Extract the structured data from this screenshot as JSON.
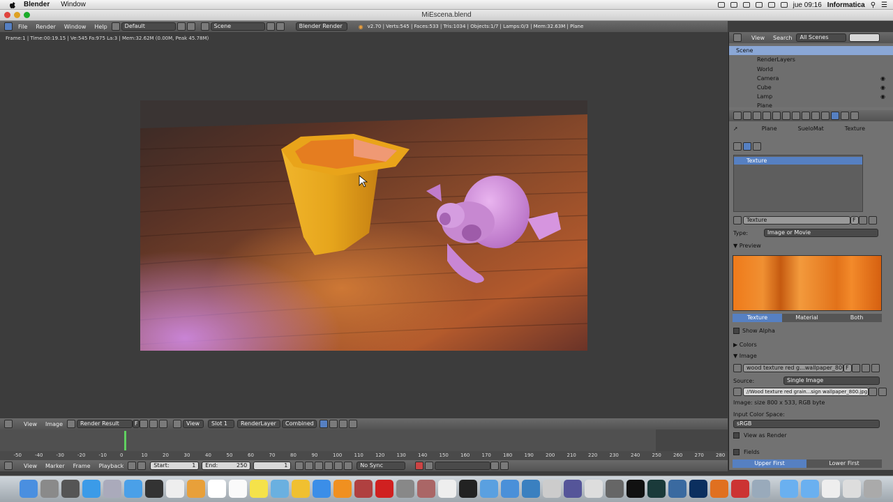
{
  "mac_menubar": {
    "app_name": "Blender",
    "menu": [
      "Window"
    ],
    "clock": "jue 09:16",
    "user": "Informatica"
  },
  "window": {
    "title": "MiEscena.blend"
  },
  "info_header": {
    "menus": [
      "File",
      "Render",
      "Window",
      "Help"
    ],
    "layout": "Default",
    "scene": "Scene",
    "engine": "Blender Render",
    "stats": "v2.70 | Verts:545 | Faces:533 | Tris:1034 | Objects:1/7 | Lamps:0/3 | Mem:32.63M | Plane"
  },
  "render_status": "Frame:1 | Time:00:19.15 | Ve:545 Fa:975 La:3 | Mem:32.62M (0.00M, Peak 45.78M)",
  "image_editor_header": {
    "menus": [
      "View",
      "Image"
    ],
    "image_name": "Render Result",
    "f_label": "F",
    "view_mode": "View",
    "slot": "Slot 1",
    "layer": "RenderLayer",
    "pass": "Combined"
  },
  "timeline": {
    "ruler": [
      "-50",
      "-40",
      "-30",
      "-20",
      "-10",
      "0",
      "10",
      "20",
      "30",
      "40",
      "50",
      "60",
      "70",
      "80",
      "90",
      "100",
      "110",
      "120",
      "130",
      "140",
      "150",
      "160",
      "170",
      "180",
      "190",
      "200",
      "210",
      "220",
      "230",
      "240",
      "250",
      "260",
      "270",
      "280"
    ],
    "menus": [
      "View",
      "Marker",
      "Frame",
      "Playback"
    ],
    "start_label": "Start:",
    "start_value": "1",
    "end_label": "End:",
    "end_value": "250",
    "current_frame": "1",
    "sync": "No Sync"
  },
  "outliner": {
    "menus": [
      "View",
      "Search"
    ],
    "scene_filter": "All Scenes",
    "items": [
      "Scene",
      "RenderLayers",
      "World",
      "Camera",
      "Cube",
      "Lamp",
      "Plane"
    ]
  },
  "properties": {
    "breadcrumb": [
      "Plane",
      "SueloMat",
      "Texture"
    ],
    "texture_slot": "Texture",
    "texture_name": "Texture",
    "f_label": "F",
    "type_label": "Type:",
    "type_value": "Image or Movie",
    "preview_label": "Preview",
    "preview_tabs": [
      "Texture",
      "Material",
      "Both"
    ],
    "show_alpha": "Show Alpha",
    "colors_label": "Colors",
    "image_label": "Image",
    "image_file": "wood texture red g...wallpaper_800.jpg",
    "source_label": "Source:",
    "source_value": "Single Image",
    "file_path": "//Wood texture red grain...sign wallpaper_800.jpg",
    "image_info": "Image: size 800 x 533, RGB byte",
    "input_color_space_label": "Input Color Space:",
    "color_space": "sRGB",
    "view_as_render": "View as Render",
    "fields": "Fields",
    "field_order": [
      "Upper First",
      "Lower First"
    ]
  },
  "colors": {
    "accent_blue": "#5680c2",
    "cup_yellow": "#e6a51c",
    "monkey_pink": "#d08ad6",
    "wood": "#8a4a2a",
    "frame_marker": "#60d060"
  }
}
